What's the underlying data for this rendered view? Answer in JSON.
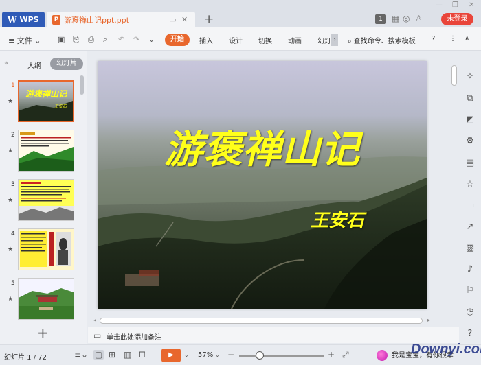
{
  "titlebar": {
    "app_tab": "WPS",
    "doc_tab": "游褒禅山记ppt.ppt",
    "badge": "1",
    "login": "未登录"
  },
  "ribbon": {
    "file_menu": "文件",
    "start": "开始",
    "tabs": [
      "插入",
      "设计",
      "切换",
      "动画",
      "幻灯"
    ],
    "search": "查找命令、搜索模板",
    "help": "?",
    "more": "⋮",
    "collapse": "∧"
  },
  "left_panel": {
    "outline_tab": "大纲",
    "slides_tab": "幻灯片",
    "thumbs": [
      {
        "num": "1",
        "title": "游褒禅山记",
        "sub": "王安石"
      },
      {
        "num": "2"
      },
      {
        "num": "3"
      },
      {
        "num": "4"
      },
      {
        "num": "5"
      }
    ]
  },
  "slide": {
    "title": "游褒禅山记",
    "author": "王安石"
  },
  "notes": {
    "placeholder": "单击此处添加备注"
  },
  "statusbar": {
    "slide_count": "幻灯片 1 / 72",
    "zoom": "57%",
    "watermark_text": "我是宝宝，有你很幸",
    "watermark_site": "Downyi.com"
  },
  "colors": {
    "accent": "#e8672d",
    "wps_blue": "#2f5bb7",
    "login_red": "#e9453a",
    "title_yellow": "#ffff1a"
  }
}
